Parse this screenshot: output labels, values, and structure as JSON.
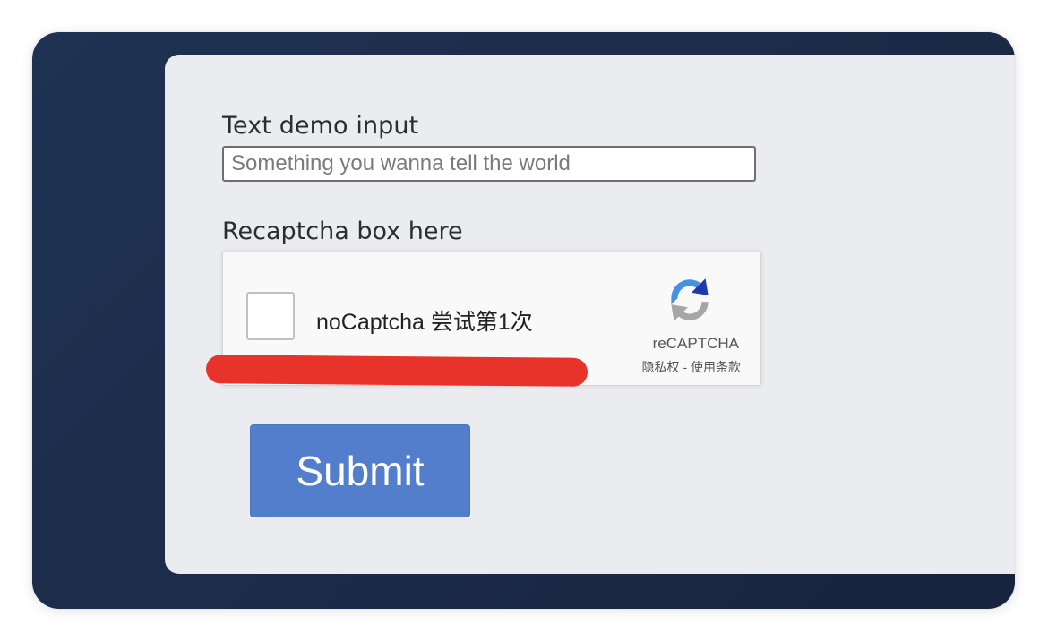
{
  "form": {
    "text_label": "Text demo input",
    "text_placeholder": "Something you wanna tell the world",
    "text_value": "",
    "recaptcha_label": "Recaptcha box here",
    "submit_label": "Submit"
  },
  "recaptcha": {
    "checkbox_label": "noCaptcha 尝试第1次",
    "brand": "reCAPTCHA",
    "privacy_link": "隐私权",
    "separator": "-",
    "terms_link": "使用条款",
    "logo_icon": "recaptcha-logo-icon"
  },
  "colors": {
    "backdrop": "#1f3253",
    "card": "#ebecef",
    "submit": "#537ecb",
    "redaction": "#e8332a"
  }
}
